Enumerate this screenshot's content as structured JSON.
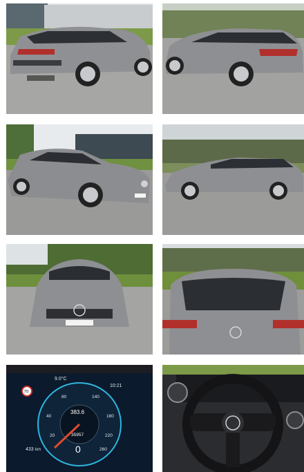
{
  "gallery": {
    "photos": [
      {
        "subject": "rear-three-quarter-left"
      },
      {
        "subject": "rear-three-quarter-right"
      },
      {
        "subject": "front-three-quarter-right"
      },
      {
        "subject": "side-left-profile"
      },
      {
        "subject": "front-view"
      },
      {
        "subject": "rear-view"
      },
      {
        "subject": "instrument-cluster"
      },
      {
        "subject": "steering-wheel"
      }
    ],
    "cluster": {
      "temperature": "9.0°C",
      "time": "10:21",
      "speed_limit": "70",
      "trip": "383.6",
      "odometer": "35957",
      "range": "433",
      "range_unit": "km",
      "speed": "0",
      "speed_unit": "km/h",
      "trip_unit": "km",
      "odo_unit": "km",
      "scale": [
        "20",
        "40",
        "60",
        "80",
        "100",
        "120",
        "140",
        "160",
        "180",
        "200",
        "220",
        "240",
        "260"
      ]
    },
    "colors": {
      "car_body": "#8e8f92",
      "sky": "#e9ecef",
      "grass": "#6f8f3a",
      "asphalt": "#9c9c9a",
      "cluster_bg": "#0b1a2c",
      "cluster_accent": "#2fb6e0",
      "needle": "#e24b2f"
    }
  }
}
